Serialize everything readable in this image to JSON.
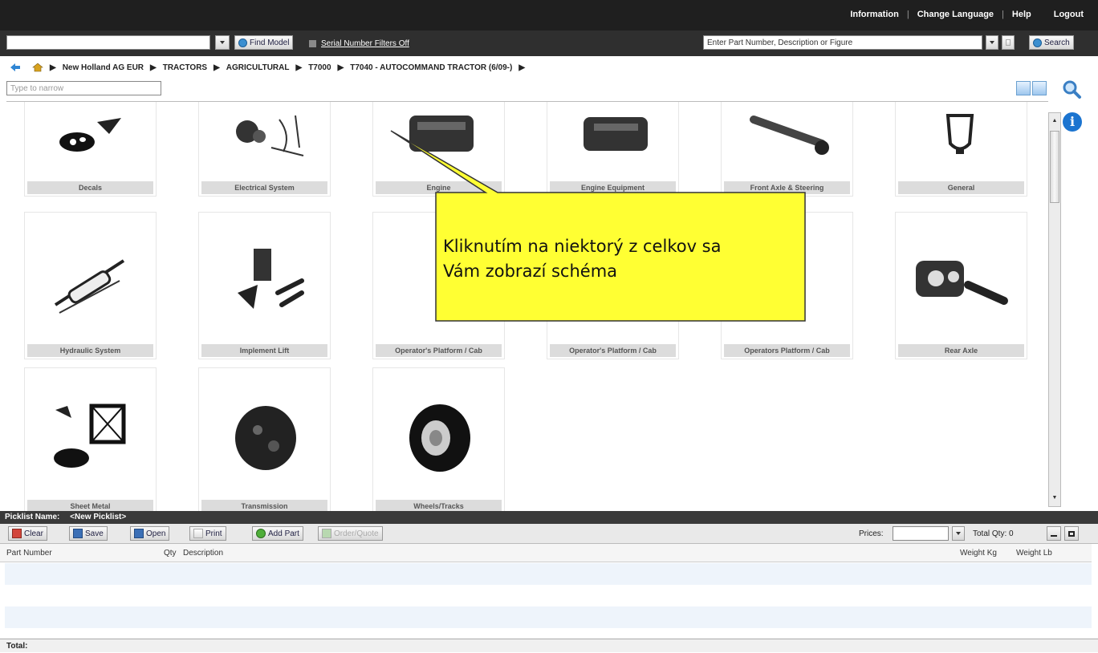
{
  "header": {
    "links": [
      "Information",
      "Change Language",
      "Help"
    ],
    "logout": "Logout"
  },
  "toolbar": {
    "model_input_value": "",
    "find_model_label": "Find Model",
    "serial_filter_label": "Serial Number Filters Off",
    "search_placeholder": "Enter Part Number, Description or Figure",
    "search_label": "Search"
  },
  "breadcrumb": [
    "New Holland AG EUR",
    "TRACTORS",
    "AGRICULTURAL",
    "T7000",
    "T7040 - AUTOCOMMAND TRACTOR (6/09-)"
  ],
  "narrow": {
    "placeholder": "Type to narrow"
  },
  "tiles": [
    "Decals",
    "Electrical System",
    "Engine",
    "Engine Equipment",
    "Front Axle & Steering",
    "General",
    "Hydraulic System",
    "Implement Lift",
    "Operator's Platform / Cab",
    "Operator's Platform / Cab",
    "Operators Platform / Cab",
    "Rear Axle",
    "Sheet Metal",
    "Transmission",
    "Wheels/Tracks"
  ],
  "callout": {
    "line1": "Kliknutím na niektorý z celkov sa",
    "line2": "Vám zobrazí schéma",
    "color": "#ffff33"
  },
  "picklist": {
    "name_label": "Picklist Name:",
    "name_value": "<New Picklist>",
    "buttons": [
      "Clear",
      "Save",
      "Open",
      "Print",
      "Add Part",
      "Order/Quote"
    ],
    "prices_label": "Prices:",
    "total_qty": "Total Qty: 0",
    "columns": [
      "Part Number",
      "Qty",
      "Description",
      "Weight Kg",
      "Weight Lb"
    ],
    "total_label": "Total:"
  },
  "icons": {
    "back": "back-arrow-icon",
    "home": "home-icon",
    "search": "magnifier-icon",
    "info": "info-icon"
  }
}
